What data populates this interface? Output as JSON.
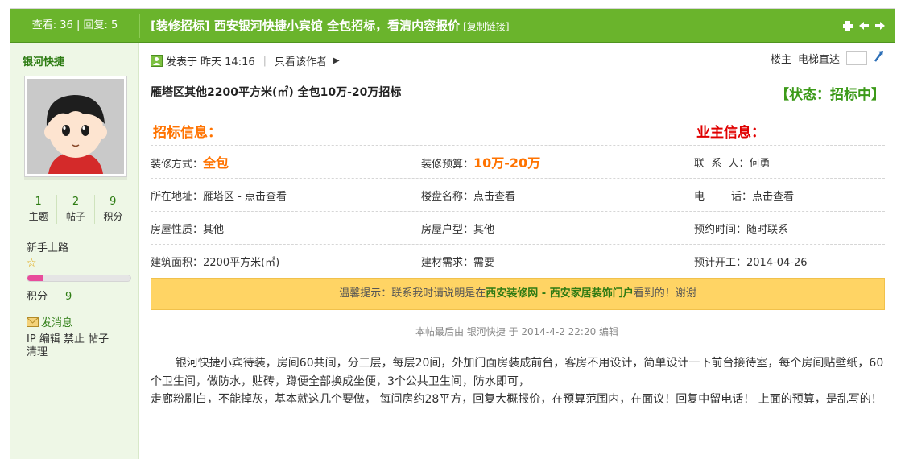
{
  "topbar": {
    "views_label": "查看:",
    "views": "36",
    "replies_label": "回复:",
    "replies": "5",
    "title": "[装修招标] 西安银河快捷小宾馆 全包招标，看清内容报价",
    "copy_link": "[复制链接]"
  },
  "author": {
    "name": "银河快捷",
    "stats": [
      {
        "num": "1",
        "label": "主题"
      },
      {
        "num": "2",
        "label": "帖子"
      },
      {
        "num": "9",
        "label": "积分"
      }
    ],
    "rank": "新手上路",
    "points_label": "积分",
    "points": "9",
    "progress": 0.15,
    "send_message": "发消息",
    "admin_actions": [
      "IP",
      "编辑",
      "禁止",
      "帖子",
      "清理"
    ]
  },
  "post": {
    "posted_prefix": "发表于",
    "posted_time": "昨天 14:16",
    "only_author": "只看该作者",
    "floor_label": "楼主",
    "elevator_label": "电梯直达",
    "headline": "雁塔区其他2200平方米(㎡) 全包10万-20万招标",
    "status": "【状态：招标中】",
    "bid_info_title": "招标信息：",
    "owner_info_title": "业主信息：",
    "rows": [
      [
        {
          "label": "装修方式：",
          "value": "全包",
          "big": true
        },
        {
          "label": "装修预算：",
          "value": "10万-20万",
          "big": true
        },
        {
          "label": "联  系  人：",
          "value": "何勇",
          "big": false
        }
      ],
      [
        {
          "label": "所在地址：",
          "value": "雁塔区 - 点击查看",
          "big": false
        },
        {
          "label": "楼盘名称：",
          "value": "点击查看",
          "big": false
        },
        {
          "label": "电        话：",
          "value": "点击查看",
          "big": false
        }
      ],
      [
        {
          "label": "房屋性质：",
          "value": "其他",
          "big": false
        },
        {
          "label": "房屋户型：",
          "value": "其他",
          "big": false
        },
        {
          "label": "预约时间：",
          "value": "随时联系",
          "big": false
        }
      ],
      [
        {
          "label": "建筑面积：",
          "value": "2200平方米(㎡)",
          "big": false
        },
        {
          "label": "建材需求：",
          "value": "需要",
          "big": false
        },
        {
          "label": "预计开工：",
          "value": "2014-04-26",
          "big": false
        }
      ]
    ],
    "tip_prefix": "温馨提示：联系我时请说明是在",
    "tip_site": "西安装修网 - 西安家居装饰门户",
    "tip_suffix": "看到的！谢谢",
    "edited_note": "本帖最后由 银河快捷 于 2014-4-2 22:20 编辑",
    "content_para1": "银河快捷小宾待装，房间60共间，分三层，每层20间，外加门面房装成前台，客房不用设计，简单设计一下前台接待室，每个房间贴壁纸，60个卫生间，做防水，贴砖，蹲便全部换成坐便，3个公共卫生间，防水即可，",
    "content_para2": "走廊粉刷白，不能掉灰，基本就这几个要做， 每间房约28平方，回复大概报价，在预算范围内，在面议！回复中留电话！ 上面的预算，是乱写的！"
  },
  "colors": {
    "green_bar": "#6ab42c",
    "orange": "#ff7300",
    "red": "#e00000",
    "tip_bg": "#ffd464"
  }
}
